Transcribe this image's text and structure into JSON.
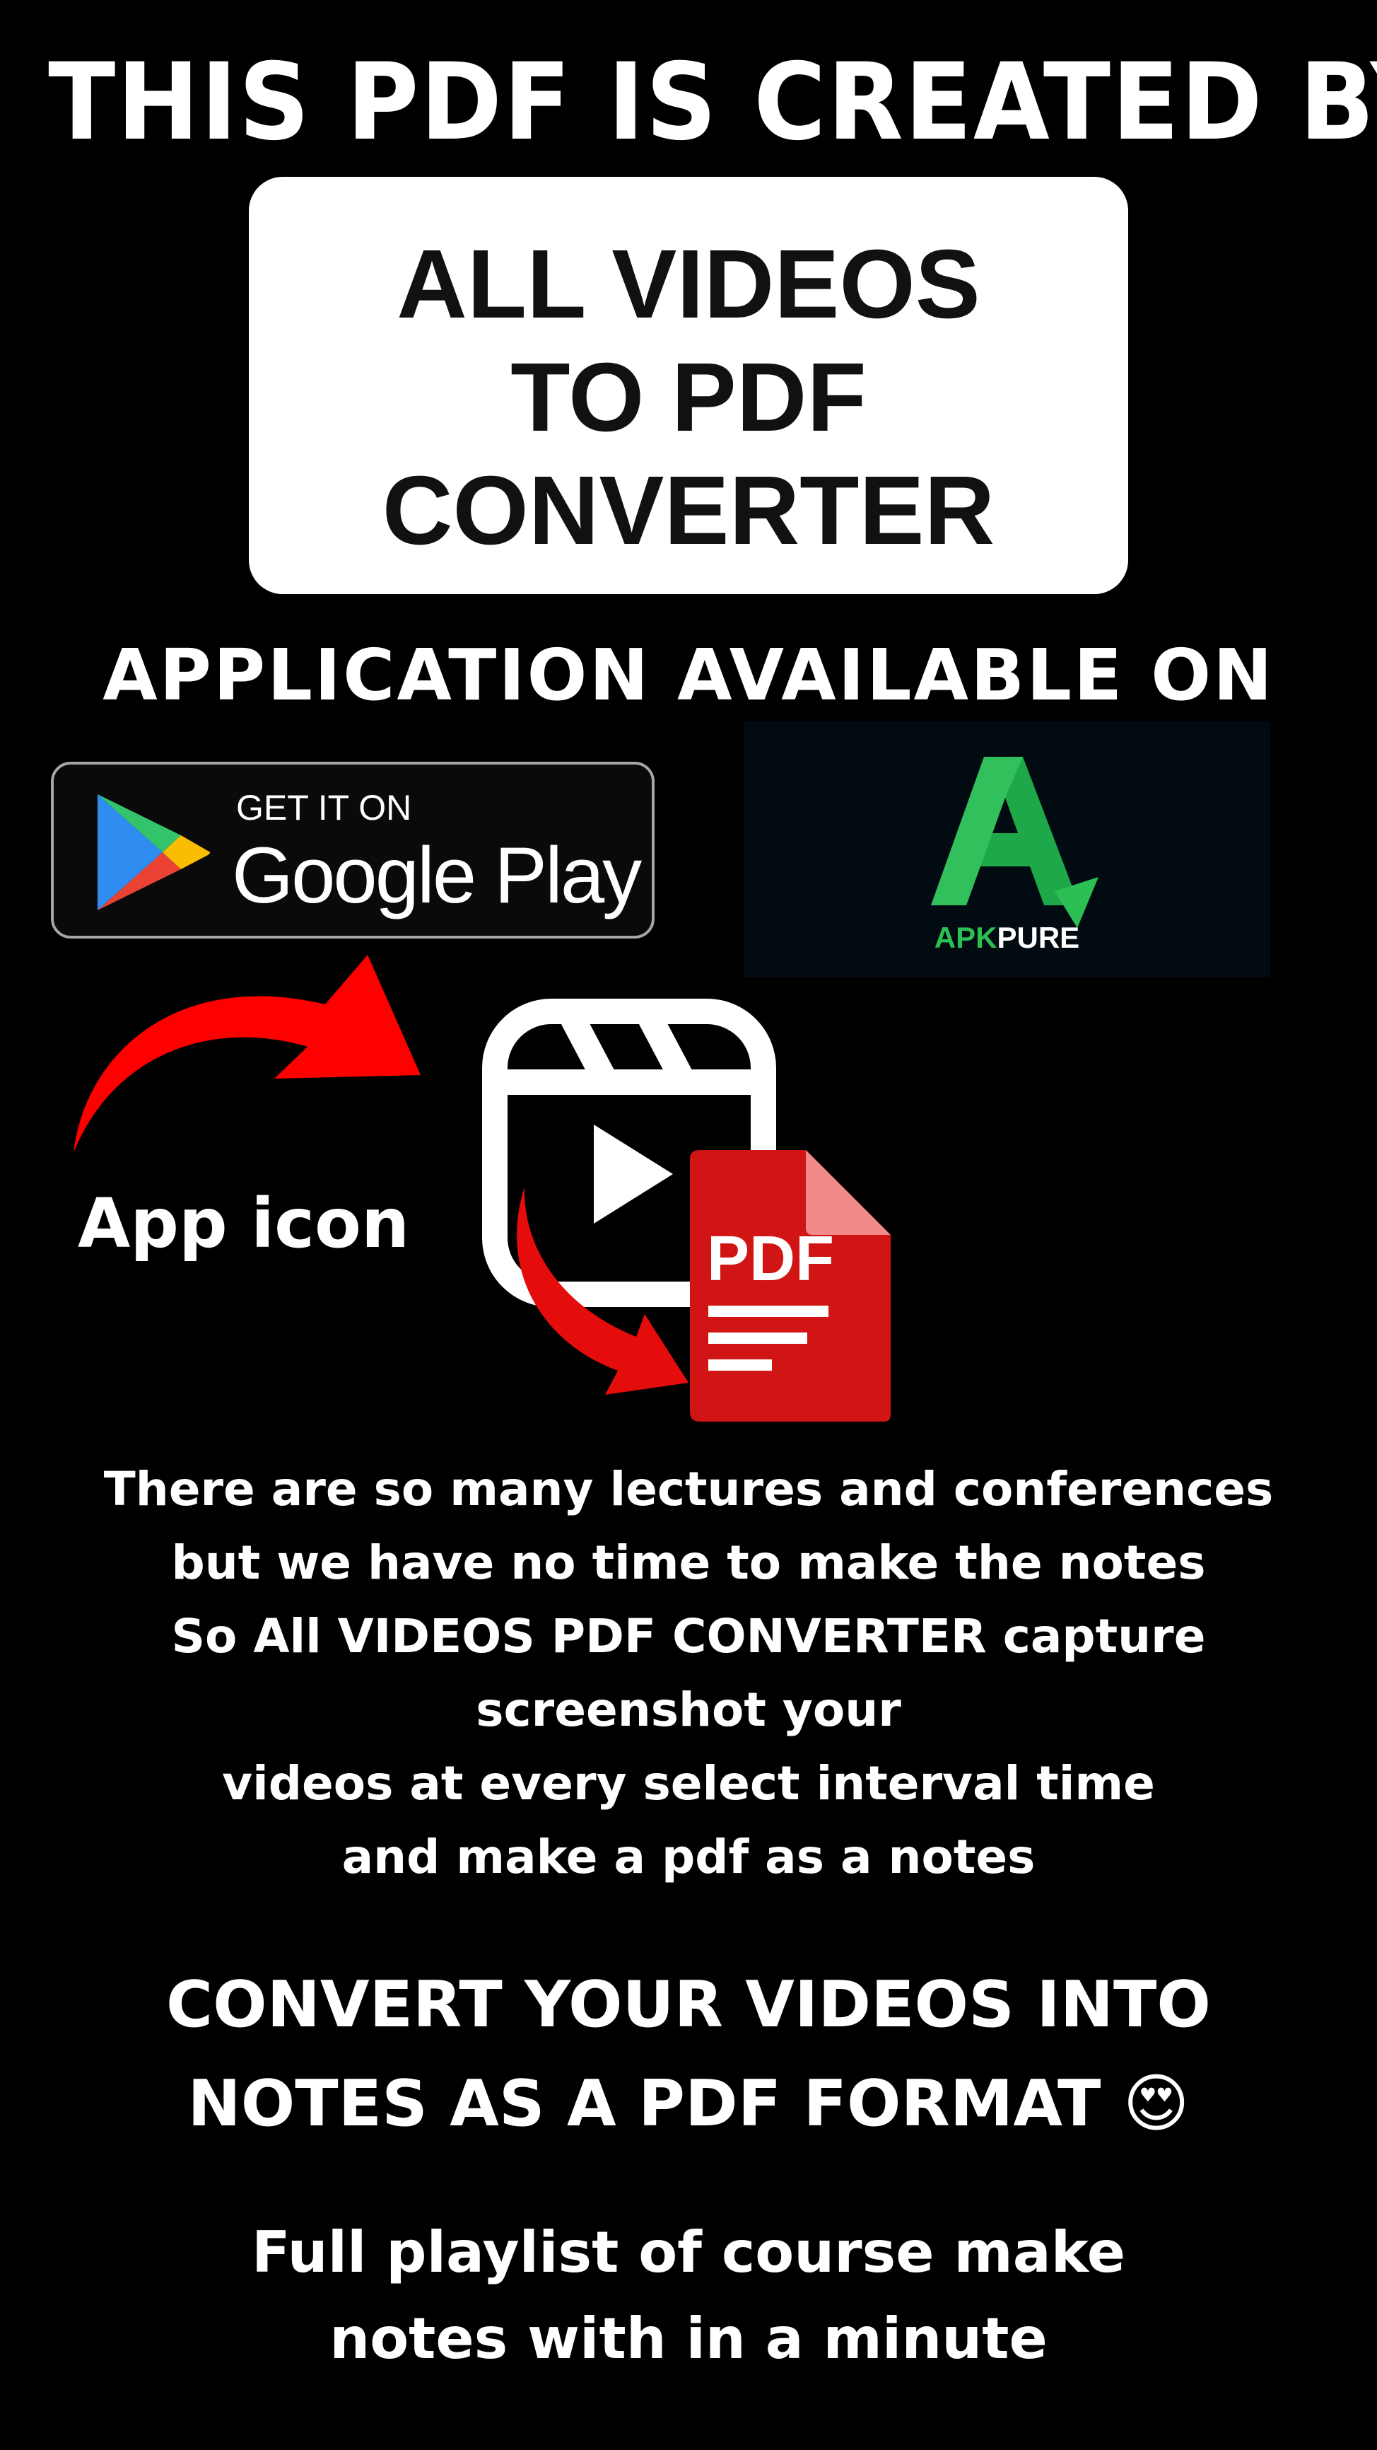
{
  "header": {
    "title": "THIS PDF IS CREATED BY"
  },
  "brand": {
    "lines": [
      "ALL VIDEOS",
      "TO PDF",
      "CONVERTER"
    ]
  },
  "availability": {
    "heading": "APPLICATION AVAILABLE ON"
  },
  "google_play": {
    "get_it_on": "GET IT ON",
    "store_name": "Google Play"
  },
  "apkpure": {
    "prefix": "APK",
    "suffix": "PURE"
  },
  "app_icon": {
    "label": "App icon",
    "badge_text": "PDF"
  },
  "description": {
    "lines": [
      "There are so many lectures and conferences",
      "but we have no time to make the notes",
      "So All VIDEOS PDF CONVERTER capture",
      "screenshot your",
      "videos at every select interval time",
      "and make a pdf as a notes"
    ]
  },
  "tagline": {
    "lines": [
      "CONVERT YOUR VIDEOS INTO",
      "NOTES AS A PDF FORMAT 😍"
    ]
  },
  "footer": {
    "lines": [
      "Full playlist of course make",
      "notes with in a minute"
    ]
  },
  "colors": {
    "background": "#000000",
    "text": "#ffffff",
    "arrow_red": "#ff0000",
    "pdf_red": "#d11414",
    "apk_green": "#2bbf54"
  }
}
